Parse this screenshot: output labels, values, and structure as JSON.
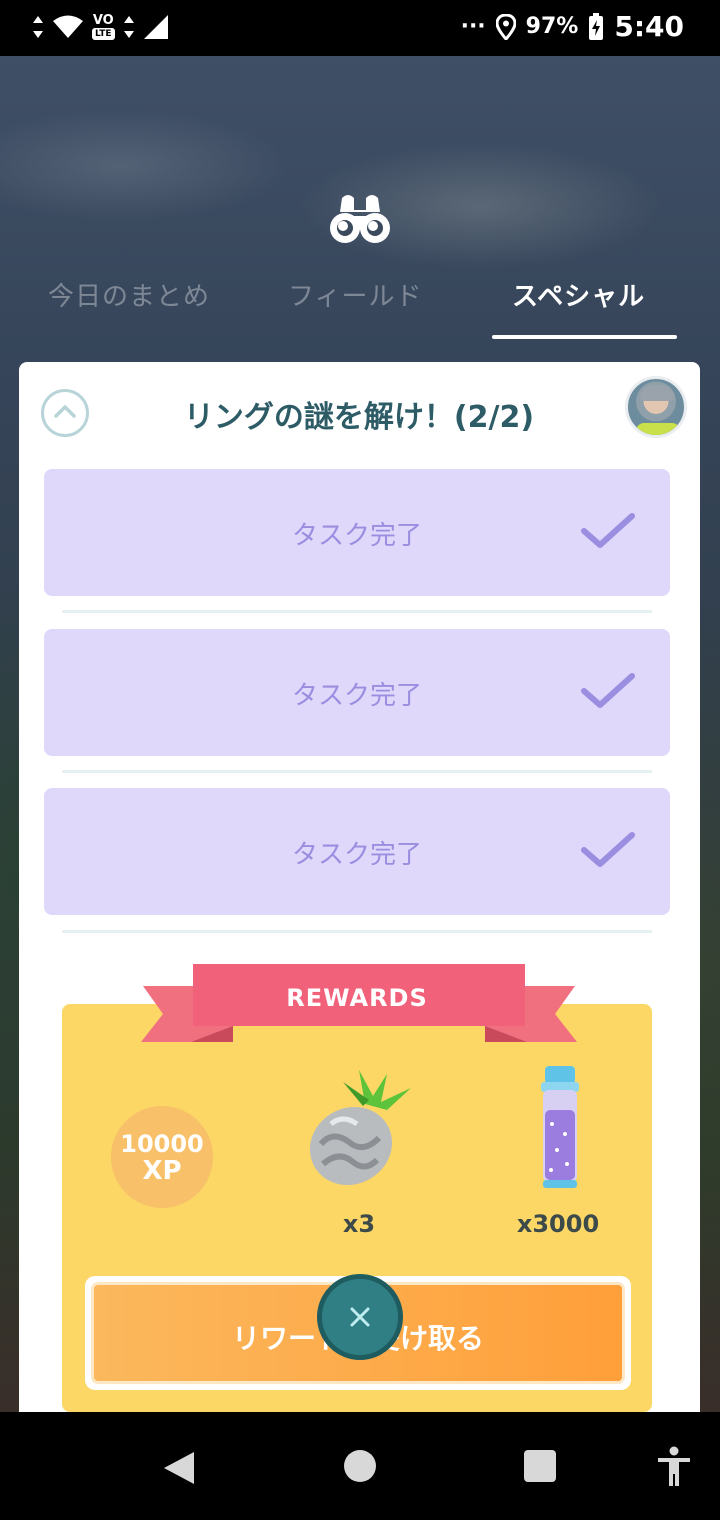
{
  "status_bar": {
    "vo": "VO",
    "lte": "LTE",
    "overflow": "···",
    "battery": "97%",
    "time": "5:40"
  },
  "header": {
    "tabs": [
      {
        "label": "今日のまとめ",
        "active": false
      },
      {
        "label": "フィールド",
        "active": false
      },
      {
        "label": "スペシャル",
        "active": true
      }
    ]
  },
  "research": {
    "title": "リングの謎を解け！(2/2)",
    "tasks": [
      {
        "label": "タスク完了"
      },
      {
        "label": "タスク完了"
      },
      {
        "label": "タスク完了"
      }
    ]
  },
  "rewards": {
    "banner": "REWARDS",
    "xp_value": "10000",
    "xp_unit": "XP",
    "items": [
      {
        "icon": "silver-pinap-berry-icon",
        "qty": "x3"
      },
      {
        "icon": "stardust-vial-icon",
        "qty": "x3000"
      }
    ],
    "claim_label": "リワードを受け取る"
  },
  "colors": {
    "task_bg": "#e0d8fb",
    "rewards_bg": "#fcd766",
    "claim_button": "#ff9f3a",
    "title": "#2d5b66"
  }
}
